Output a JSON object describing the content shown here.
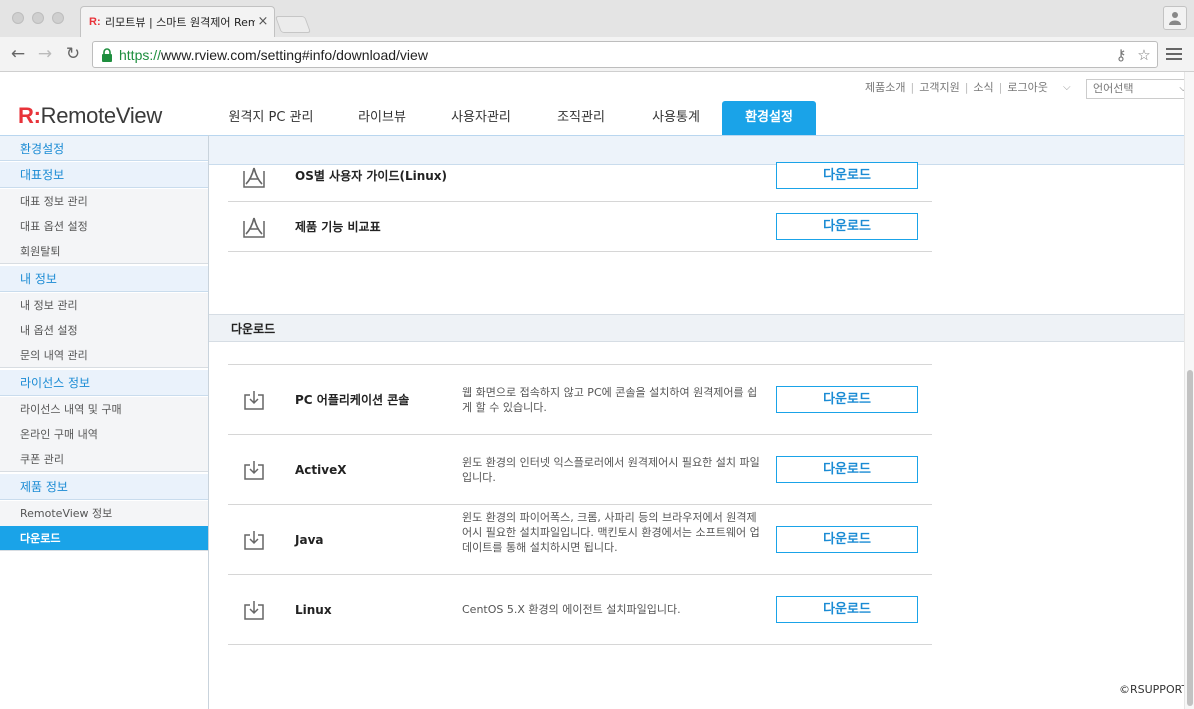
{
  "browser": {
    "tab_title": "리모트뷰 | 스마트 원격제어 Rem",
    "tab_favicon": "R:",
    "tab_close": "×",
    "url_scheme": "https://",
    "url_rest": "www.rview.com/setting#info/download/view",
    "icons": {
      "back": "back-arrow-icon",
      "forward": "forward-arrow-icon",
      "reload": "reload-icon",
      "lock": "lock-icon",
      "key": "key-icon",
      "star": "bookmark-star-icon",
      "menu": "hamburger-menu-icon",
      "profile": "profile-icon"
    }
  },
  "brand": {
    "logo_mark": "R:",
    "logo_text": "RemoteView",
    "color_accent": "#1aa3e8",
    "color_logo": "#e8333a"
  },
  "util": {
    "links": [
      "제품소개",
      "고객지원",
      "소식",
      "로그아웃"
    ],
    "language_select": "언어선택"
  },
  "gnb": {
    "items": [
      "원격지 PC 관리",
      "라이브뷰",
      "사용자관리",
      "조직관리",
      "사용통계",
      "환경설정"
    ],
    "active": "환경설정"
  },
  "sidebar": {
    "title": "환경설정",
    "groups": [
      {
        "title": "대표정보",
        "items": [
          "대표 정보 관리",
          "대표 옵션 설정",
          "회원탈퇴"
        ]
      },
      {
        "title": "내 정보",
        "items": [
          "내 정보 관리",
          "내 옵션 설정",
          "문의 내역 관리"
        ]
      },
      {
        "title": "라이선스 정보",
        "items": [
          "라이선스 내역 및 구매",
          "온라인 구매 내역",
          "쿠폰 관리"
        ]
      },
      {
        "title": "제품 정보",
        "items": [
          "RemoteView 정보",
          "다운로드"
        ]
      }
    ],
    "active_item": "다운로드"
  },
  "documents": [
    {
      "name": "OS별 사용자 가이드(Linux)",
      "button": "다운로드",
      "icon": "pdf-icon"
    },
    {
      "name": "제품 기능 비교표",
      "button": "다운로드",
      "icon": "pdf-icon"
    }
  ],
  "download_section": {
    "title": "다운로드",
    "items": [
      {
        "name": "PC 어플리케이션 콘솔",
        "desc": "웹 화면으로 접속하지 않고 PC에 콘솔을 설치하여 원격제어를 쉽게 할 수 있습니다.",
        "button": "다운로드",
        "icon": "download-box-icon"
      },
      {
        "name": "ActiveX",
        "desc": "윈도 환경의 인터넷 익스플로러에서 원격제어시 필요한 설치 파일입니다.",
        "button": "다운로드",
        "icon": "download-box-icon"
      },
      {
        "name": "Java",
        "desc": "윈도 환경의 파이어폭스, 크롬, 사파리 등의 브라우저에서 원격제어시 필요한 설치파일입니다. 맥킨토시 환경에서는 소프트웨어 업데이트를 통해 설치하시면 됩니다.",
        "button": "다운로드",
        "icon": "download-box-icon"
      },
      {
        "name": "Linux",
        "desc": "CentOS 5.X 환경의 에이전트 설치파일입니다.",
        "button": "다운로드",
        "icon": "download-box-icon"
      }
    ]
  },
  "footer": {
    "copyright": "©RSUPPORT"
  }
}
